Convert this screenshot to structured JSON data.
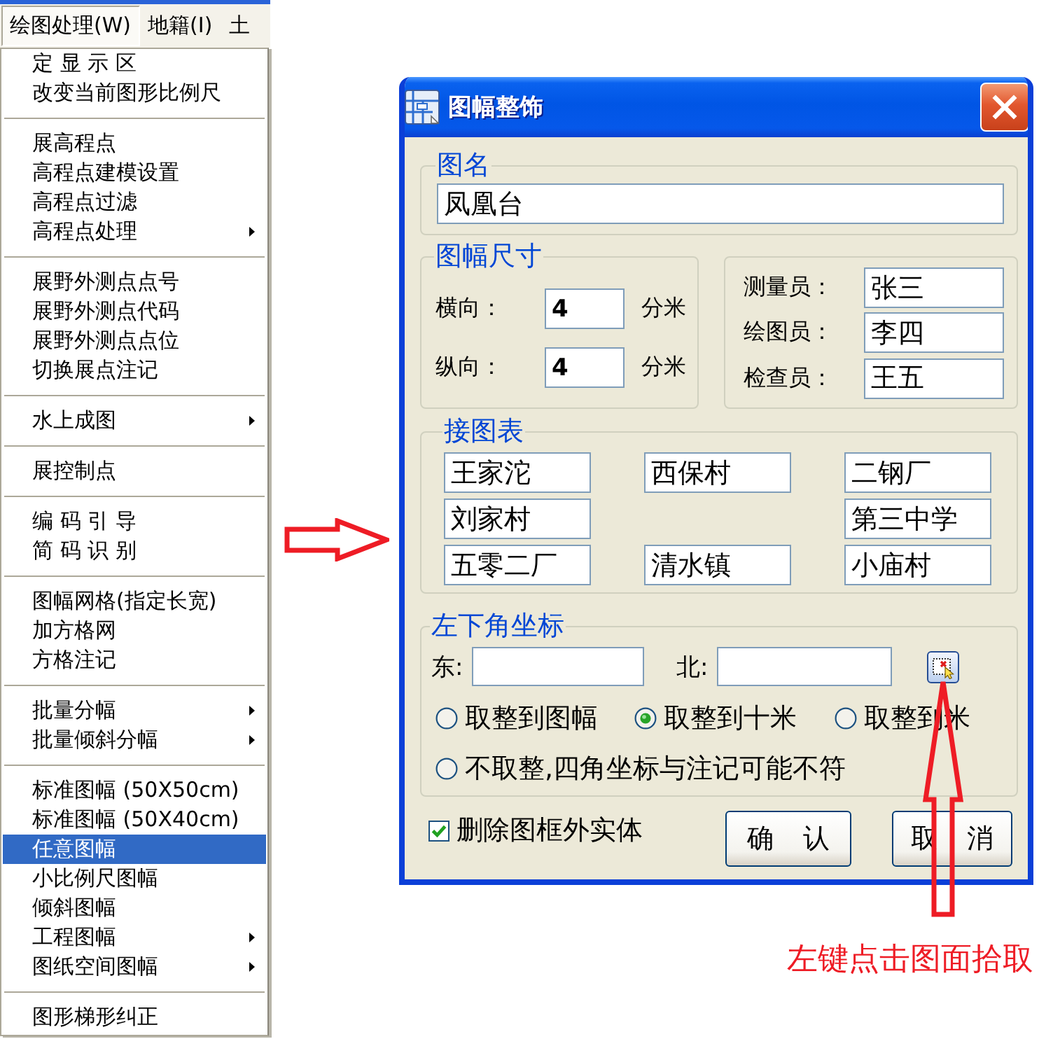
{
  "menu_bar": {
    "items": [
      {
        "label": "绘图处理(W)",
        "selected": true
      },
      {
        "label": "地籍(I)",
        "selected": false
      },
      {
        "label": "土",
        "selected": false
      }
    ]
  },
  "dropdown_menu": {
    "groups": [
      {
        "items": [
          {
            "label": "定 显 示 区",
            "selected": false,
            "submenu": false
          },
          {
            "label": "改变当前图形比例尺",
            "selected": false,
            "submenu": false
          }
        ]
      },
      {
        "items": [
          {
            "label": "展高程点",
            "selected": false,
            "submenu": false
          },
          {
            "label": "高程点建模设置",
            "selected": false,
            "submenu": false
          },
          {
            "label": "高程点过滤",
            "selected": false,
            "submenu": false
          },
          {
            "label": "高程点处理",
            "selected": false,
            "submenu": true
          }
        ]
      },
      {
        "items": [
          {
            "label": "展野外测点点号",
            "selected": false,
            "submenu": false
          },
          {
            "label": "展野外测点代码",
            "selected": false,
            "submenu": false
          },
          {
            "label": "展野外测点点位",
            "selected": false,
            "submenu": false
          },
          {
            "label": "切换展点注记",
            "selected": false,
            "submenu": false
          }
        ]
      },
      {
        "items": [
          {
            "label": "水上成图",
            "selected": false,
            "submenu": true
          }
        ]
      },
      {
        "items": [
          {
            "label": "展控制点",
            "selected": false,
            "submenu": false
          }
        ]
      },
      {
        "items": [
          {
            "label": "编 码 引 导",
            "selected": false,
            "submenu": false
          },
          {
            "label": "简 码 识 别",
            "selected": false,
            "submenu": false
          }
        ]
      },
      {
        "items": [
          {
            "label": "图幅网格(指定长宽)",
            "selected": false,
            "submenu": false
          },
          {
            "label": "加方格网",
            "selected": false,
            "submenu": false
          },
          {
            "label": "方格注记",
            "selected": false,
            "submenu": false
          }
        ]
      },
      {
        "items": [
          {
            "label": "批量分幅",
            "selected": false,
            "submenu": true
          },
          {
            "label": "批量倾斜分幅",
            "selected": false,
            "submenu": true
          }
        ]
      },
      {
        "items": [
          {
            "label": "标准图幅 (50X50cm)",
            "selected": false,
            "submenu": false
          },
          {
            "label": "标准图幅 (50X40cm)",
            "selected": false,
            "submenu": false
          },
          {
            "label": "任意图幅",
            "selected": true,
            "submenu": false
          },
          {
            "label": "小比例尺图幅",
            "selected": false,
            "submenu": false
          },
          {
            "label": "倾斜图幅",
            "selected": false,
            "submenu": false
          },
          {
            "label": "工程图幅",
            "selected": false,
            "submenu": true
          },
          {
            "label": "图纸空间图幅",
            "selected": false,
            "submenu": true
          }
        ]
      },
      {
        "items": [
          {
            "label": "图形梯形纠正",
            "selected": false,
            "submenu": false
          }
        ]
      }
    ]
  },
  "dialog": {
    "title": "图幅整饰",
    "map_name": {
      "legend": "图名",
      "value": "凤凰台"
    },
    "map_size": {
      "legend": "图幅尺寸",
      "rows": [
        {
          "label": "横向：",
          "value": "4",
          "unit": "分米"
        },
        {
          "label": "纵向：",
          "value": "4",
          "unit": "分米"
        }
      ]
    },
    "staff": [
      {
        "label": "测量员：",
        "value": "张三"
      },
      {
        "label": "绘图员：",
        "value": "李四"
      },
      {
        "label": "检查员：",
        "value": "王五"
      }
    ],
    "adjoining_sheets": {
      "legend": "接图表",
      "rows": [
        [
          "王家沱",
          "西保村",
          "二钢厂"
        ],
        [
          "刘家村",
          null,
          "第三中学"
        ],
        [
          "五零二厂",
          "清水镇",
          "小庙村"
        ]
      ]
    },
    "lower_left_corner": {
      "legend": "左下角坐标",
      "east_label": "东:",
      "north_label": "北:",
      "rounding": [
        [
          {
            "label": "取整到图幅",
            "selected": false
          },
          {
            "label": "取整到十米",
            "selected": true
          },
          {
            "label": "取整到米",
            "selected": false
          }
        ],
        [
          {
            "label": "不取整,四角坐标与注记可能不符",
            "selected": false
          }
        ]
      ]
    },
    "delete_outside_frame": {
      "label": "删除图框外实体",
      "checked": true
    },
    "buttons": [
      "确 认",
      "取 消"
    ]
  },
  "annotation": {
    "text": "左键点击图面拾取"
  }
}
